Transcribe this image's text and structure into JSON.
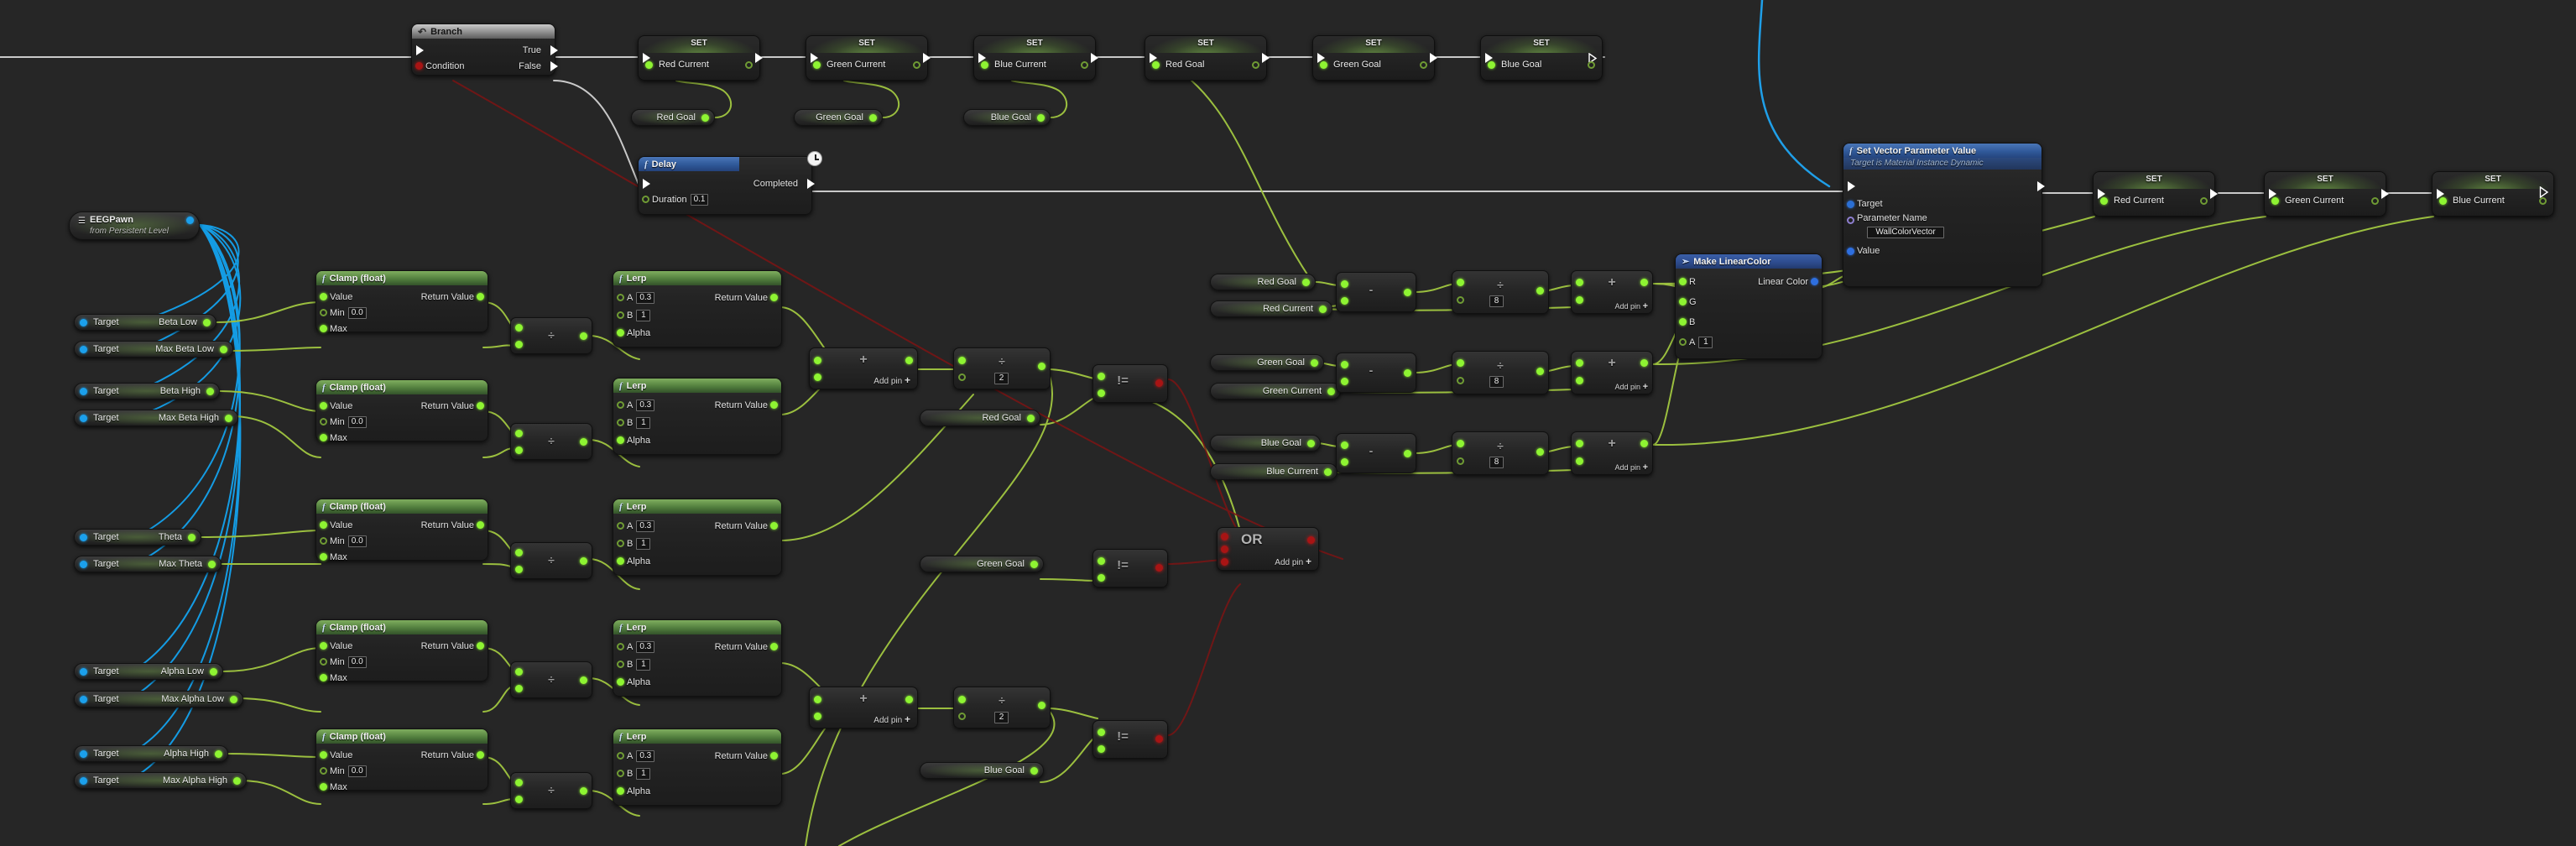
{
  "app": {
    "title": "Unreal Engine Blueprint Event Graph",
    "background_color": "#262626",
    "wire_colors": {
      "exec": "#ffffff",
      "float": "#9bbf3f",
      "bool": "#a01010",
      "object": "#12a7f0",
      "linear_color": "#2e6fe0"
    }
  },
  "nodes": {
    "branch": {
      "title": "Branch",
      "icon": "branch-icon",
      "pins": {
        "exec_in": "",
        "condition": "Condition",
        "true": "True",
        "false": "False"
      }
    },
    "delay": {
      "title": "Delay",
      "icon": "function-icon",
      "badge": "clock-icon",
      "pins": {
        "completed": "Completed",
        "duration": "Duration"
      },
      "values": {
        "duration": "0.1"
      }
    },
    "set_top": [
      {
        "label": "SET",
        "variable": "Red Current"
      },
      {
        "label": "SET",
        "variable": "Green Current"
      },
      {
        "label": "SET",
        "variable": "Blue Current"
      },
      {
        "label": "SET",
        "variable": "Red Goal"
      },
      {
        "label": "SET",
        "variable": "Green Goal"
      },
      {
        "label": "SET",
        "variable": "Blue Goal"
      }
    ],
    "set_right": [
      {
        "label": "SET",
        "variable": "Red Current"
      },
      {
        "label": "SET",
        "variable": "Green Current"
      },
      {
        "label": "SET",
        "variable": "Blue Current"
      }
    ],
    "goal_pills_top": [
      {
        "label": "Red Goal"
      },
      {
        "label": "Green Goal"
      },
      {
        "label": "Blue Goal"
      }
    ],
    "actor_ref": {
      "title": "EEGPawn",
      "subtitle": "from Persistent Level",
      "icon": "actor-icon"
    },
    "variable_getters": [
      {
        "target": "Target",
        "name": "Beta Low"
      },
      {
        "target": "Target",
        "name": "Max Beta Low"
      },
      {
        "target": "Target",
        "name": "Beta High"
      },
      {
        "target": "Target",
        "name": "Max Beta High"
      },
      {
        "target": "Target",
        "name": "Theta"
      },
      {
        "target": "Target",
        "name": "Max Theta"
      },
      {
        "target": "Target",
        "name": "Alpha Low"
      },
      {
        "target": "Target",
        "name": "Max Alpha Low"
      },
      {
        "target": "Target",
        "name": "Alpha High"
      },
      {
        "target": "Target",
        "name": "Max Alpha High"
      }
    ],
    "clamps": [
      {
        "title": "Clamp (float)",
        "value": "Value",
        "min": "Min",
        "max": "Max",
        "return": "Return Value",
        "min_value": "0.0"
      },
      {
        "title": "Clamp (float)",
        "value": "Value",
        "min": "Min",
        "max": "Max",
        "return": "Return Value",
        "min_value": "0.0"
      },
      {
        "title": "Clamp (float)",
        "value": "Value",
        "min": "Min",
        "max": "Max",
        "return": "Return Value",
        "min_value": "0.0"
      },
      {
        "title": "Clamp (float)",
        "value": "Value",
        "min": "Min",
        "max": "Max",
        "return": "Return Value",
        "min_value": "0.0"
      },
      {
        "title": "Clamp (float)",
        "value": "Value",
        "min": "Min",
        "max": "Max",
        "return": "Return Value",
        "min_value": "0.0"
      }
    ],
    "lerps": [
      {
        "title": "Lerp",
        "a": "A",
        "b": "B",
        "alpha": "Alpha",
        "return": "Return Value",
        "a_value": "0.3",
        "b_value": "1"
      },
      {
        "title": "Lerp",
        "a": "A",
        "b": "B",
        "alpha": "Alpha",
        "return": "Return Value",
        "a_value": "0.3",
        "b_value": "1"
      },
      {
        "title": "Lerp",
        "a": "A",
        "b": "B",
        "alpha": "Alpha",
        "return": "Return Value",
        "a_value": "0.3",
        "b_value": "1"
      },
      {
        "title": "Lerp",
        "a": "A",
        "b": "B",
        "alpha": "Alpha",
        "return": "Return Value",
        "a_value": "0.3",
        "b_value": "1"
      },
      {
        "title": "Lerp",
        "a": "A",
        "b": "B",
        "alpha": "Alpha",
        "return": "Return Value",
        "a_value": "0.3",
        "b_value": "1"
      }
    ],
    "divide_small": {
      "symbol": "÷"
    },
    "add_nodes": {
      "symbol": "+",
      "add_pin": "Add pin"
    },
    "divide_two": {
      "symbol": "÷",
      "value": "2"
    },
    "divide_eight": {
      "symbol": "÷",
      "value": "8"
    },
    "subtract": {
      "symbol": "-"
    },
    "not_equal": {
      "symbol": "!="
    },
    "or_node": {
      "symbol": "OR",
      "add_pin": "Add pin"
    },
    "goal_compare_pills": [
      {
        "label": "Red Goal"
      },
      {
        "label": "Green Goal"
      },
      {
        "label": "Blue Goal"
      }
    ],
    "rgb_pairs": [
      {
        "goal": "Red Goal",
        "current": "Red Current"
      },
      {
        "goal": "Green Goal",
        "current": "Green Current"
      },
      {
        "goal": "Blue Goal",
        "current": "Blue Current"
      }
    ],
    "make_linear_color": {
      "title": "Make LinearColor",
      "icon": "make-struct-icon",
      "pins": {
        "r": "R",
        "g": "G",
        "b": "B",
        "a": "A",
        "out": "Linear Color"
      },
      "values": {
        "a": "1"
      }
    },
    "set_vector_parameter": {
      "title": "Set Vector Parameter Value",
      "subtitle": "Target is Material Instance Dynamic",
      "icon": "function-icon",
      "pins": {
        "target": "Target",
        "parameter_name": "Parameter Name",
        "value": "Value"
      },
      "values": {
        "parameter_name": "WallColorVector"
      }
    }
  }
}
